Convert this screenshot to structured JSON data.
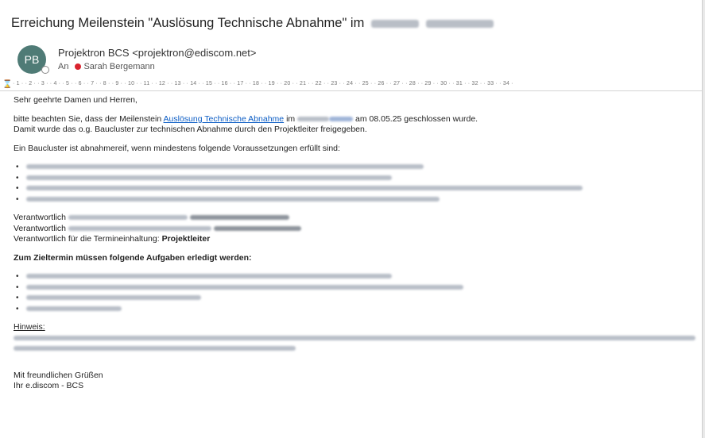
{
  "subject": {
    "prefix": "Erreichung Meilenstein \"Auslösung Technische Abnahme\" im"
  },
  "sender": {
    "initials": "PB",
    "name": "Projektron BCS <projektron@ediscom.net>"
  },
  "recipient": {
    "label": "An",
    "name": "Sarah Bergemann"
  },
  "ruler": {
    "marker": "⌛",
    "ticks": "· 1 · · 2 · · 3 · · 4 · · 5 · · 6 · · 7 · · 8 · · 9 · · 10 · · 11 · · 12 · · 13 · · 14 · · 15 · · 16 · · 17 · · 18 · · 19 · · 20 · · 21 · · 22 · · 23 · · 24 · · 25 · · 26 · · 27 · · 28 · · 29 · · 30 · · 31 · · 32 · · 33 · · 34 ·"
  },
  "body": {
    "greeting": "Sehr geehrte Damen und Herren,",
    "para1_a": "bitte beachten Sie, dass der Meilenstein",
    "para1_link": "Auslösung Technische Abnahme",
    "para1_b": "im",
    "para1_c": "am 08.05.25 geschlossen wurde.",
    "para2": "Damit wurde das o.g. Baucluster zur technischen Abnahme durch den Projektleiter freigegeben.",
    "para3": "Ein Baucluster ist abnahmereif, wenn mindestens folgende Voraussetzungen erfüllt sind:",
    "resp1": "Verantwortlich",
    "resp2": "Verantwortlich",
    "resp3_a": "Verantwortlich für die Termineinhaltung:",
    "resp3_b": "Projektleiter",
    "heading": "Zum Zieltermin müssen folgende Aufgaben erledigt werden:",
    "hint": "Hinweis:",
    "closing1": "Mit freundlichen Grüßen",
    "closing2": "Ihr e.discom - BCS"
  },
  "colors": {
    "accent": "#0b5cc4",
    "avatar": "#4f7b76",
    "presence_busy": "#d9232e"
  }
}
